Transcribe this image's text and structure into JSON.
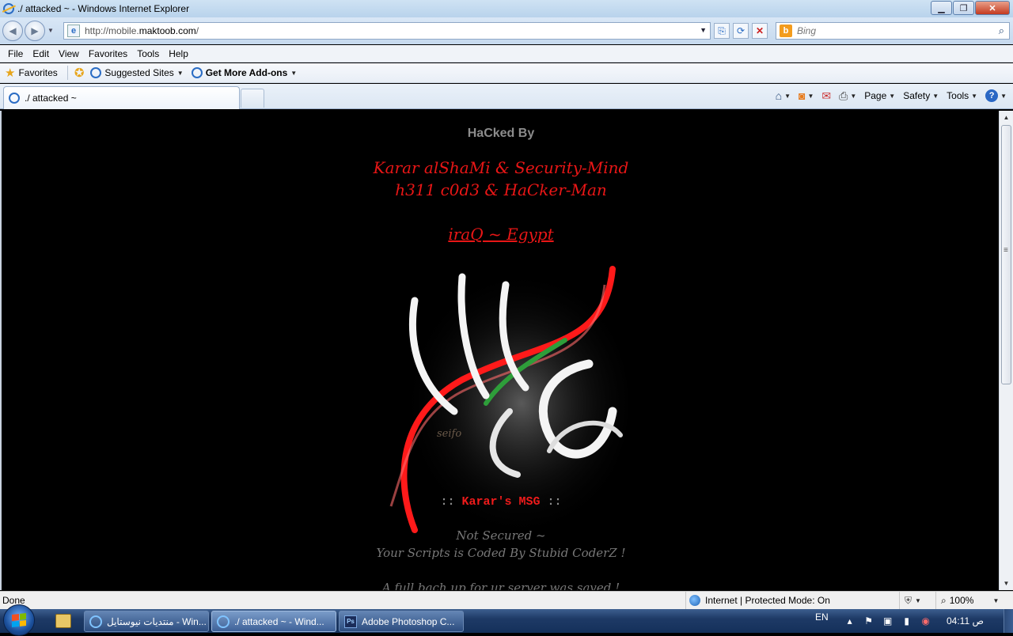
{
  "window": {
    "title": "./ attacked ~ - Windows Internet Explorer",
    "controls": {
      "minimize": "▁",
      "restore": "❐",
      "close": "✕"
    }
  },
  "address_bar": {
    "url_prefix": "http://mobile.",
    "url_domain": "maktoob.com",
    "url_suffix": "/",
    "search_placeholder": "Bing"
  },
  "menu": [
    "File",
    "Edit",
    "View",
    "Favorites",
    "Tools",
    "Help"
  ],
  "favorites_bar": {
    "favorites_label": "Favorites",
    "suggested_label": "Suggested Sites",
    "addons_label": "Get More Add-ons"
  },
  "tab": {
    "label": "./ attacked ~"
  },
  "command_bar": {
    "page": "Page",
    "safety": "Safety",
    "tools": "Tools"
  },
  "page": {
    "hacked_by": "HaCked By",
    "names_line_1": "Karar alShaMi & Security-Mind",
    "names_line_2": "h311 c0d3 & HaCker-Man",
    "country": "iraQ ~ Egypt",
    "logo_signature": "seifo",
    "msg_prefix": "::",
    "msg_title": "Karar's MSG",
    "msg_suffix": "::",
    "msg_line_1": "Not Secured ~",
    "msg_line_2": "Your Scripts is Coded By Stubid  CoderZ !",
    "msg_line_3": "A full bach up for ur server was saved !"
  },
  "status_bar": {
    "status": "Done",
    "zone": "Internet | Protected Mode: On",
    "zoom": "100%"
  },
  "taskbar": {
    "tasks": [
      {
        "label": "منتديات نيوستايل - Win..."
      },
      {
        "label": "./ attacked ~ - Wind..."
      },
      {
        "label": "Adobe Photoshop C..."
      }
    ],
    "language": "EN",
    "clock": "ص 04:11"
  },
  "colors": {
    "page_background": "#000000",
    "accent_red": "#e81616",
    "text_grey": "#8c8c8c"
  }
}
